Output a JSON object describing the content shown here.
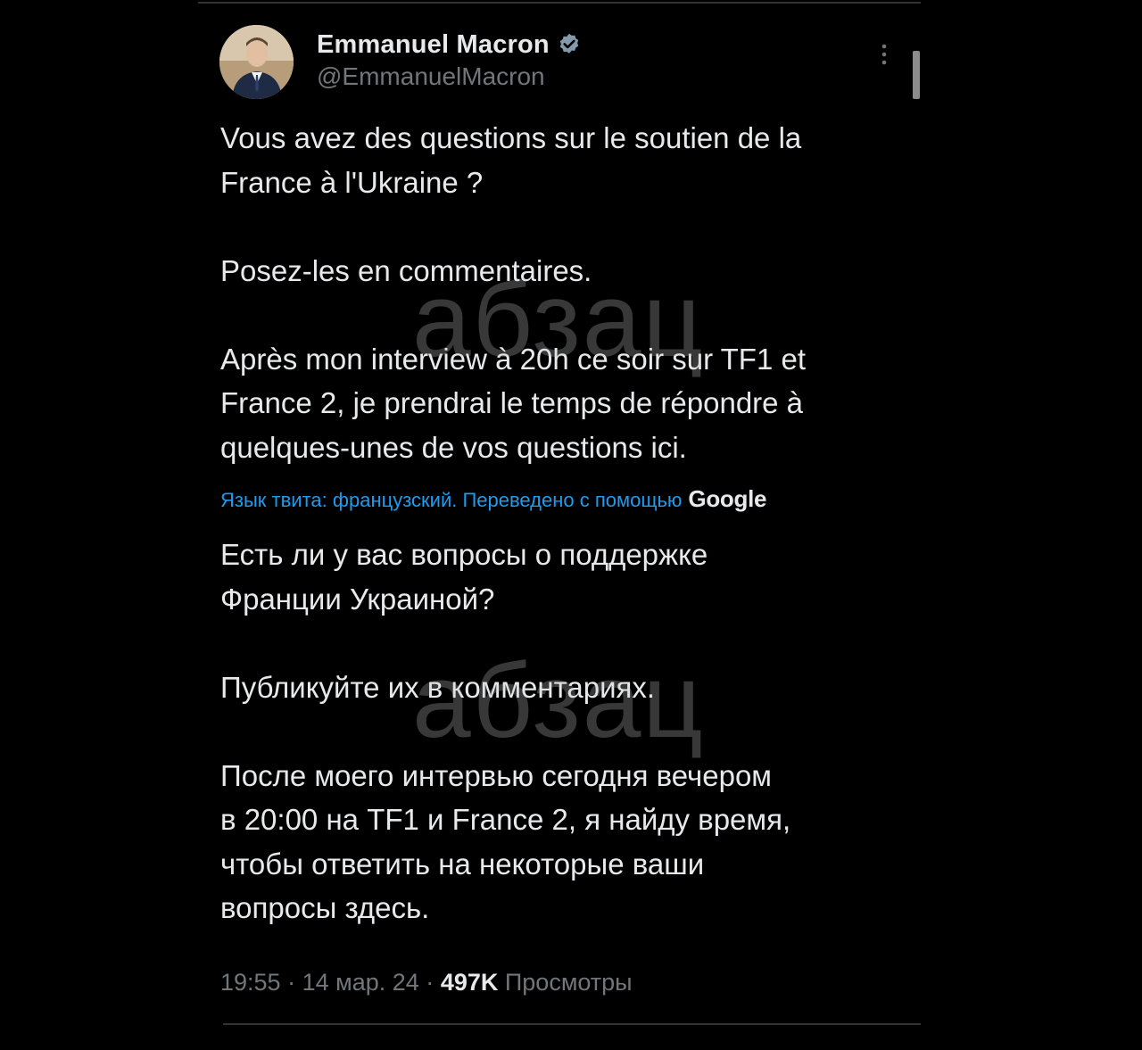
{
  "author": {
    "display_name": "Emmanuel Macron",
    "handle": "@EmmanuelMacron",
    "verified": true
  },
  "tweet": {
    "text": "Vous avez des questions sur le soutien de la\nFrance à l'Ukraine ?\n\nPosez-les en commentaires.\n\nAprès mon interview à 20h ce soir sur TF1 et\nFrance 2, je prendrai le temps de répondre à\nquelques-unes de vos questions ici.",
    "translation_note": "Язык твита: французский. Переведено с помощью",
    "translation_provider": "Google",
    "translated_text": "Есть ли у вас вопросы о поддержке\nФранции Украиной?\n\nПубликуйте их в комментариях.\n\nПосле моего интервью сегодня вечером\nв 20:00 на TF1 и France 2, я найду время,\nчтобы ответить на некоторые ваши\nвопросы здесь."
  },
  "meta": {
    "time": "19:55",
    "separator": "·",
    "date": "14 мар. 24",
    "views_count": "497K",
    "views_label": "Просмотры"
  },
  "watermark": {
    "text": "абзац"
  },
  "icons": {
    "verified": "verified-badge-icon",
    "more": "more-options-icon"
  },
  "colors": {
    "background": "#000000",
    "text": "#e7e9ea",
    "secondary": "#71767b",
    "link": "#1d9bf0"
  }
}
